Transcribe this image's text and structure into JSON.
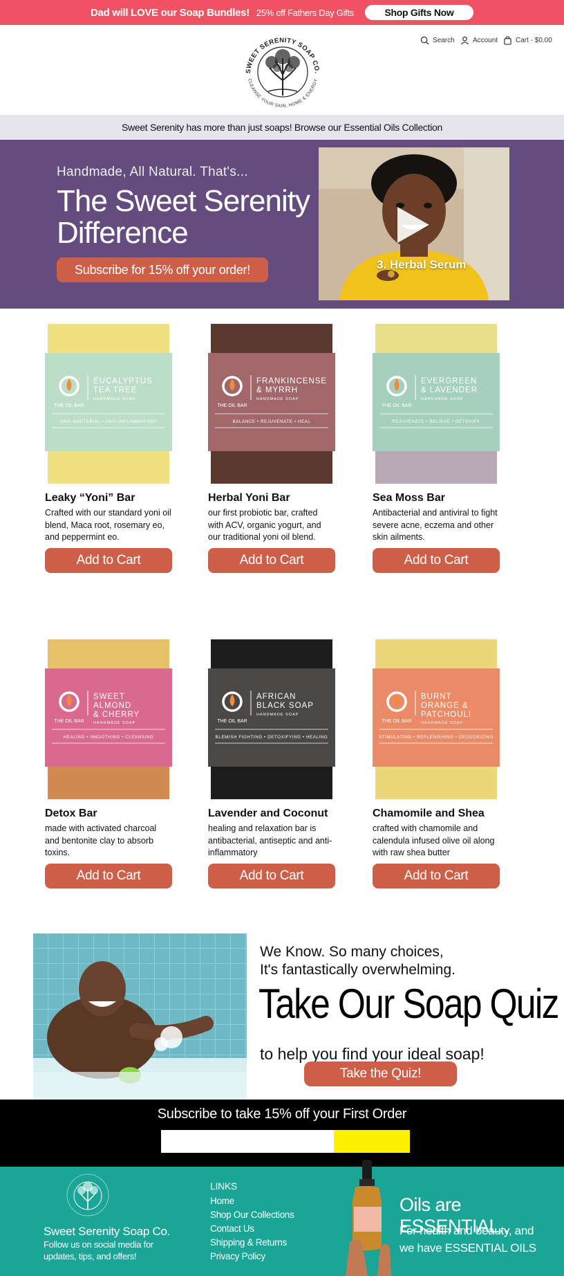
{
  "announcement": {
    "bold_text": "Dad will LOVE our Soap Bundles!",
    "thin_text": "25% off Fathers Day Gifts",
    "button_label": "Shop Gifts Now"
  },
  "header": {
    "logo_text_top": "SWEET SERENITY SOAP CO.",
    "logo_text_bottom": "CLEANSE YOUR SKIN, HOME & ENERGY",
    "search_label": "Search",
    "account_label": "Account",
    "cart_label": "Cart - $0.00"
  },
  "subbar": {
    "text": "Sweet Serenity has more than just soaps! Browse our Essential Oils Collection"
  },
  "hero": {
    "kicker": "Handmade, All Natural. That's...",
    "headline_line1": "The Sweet Serenity",
    "headline_line2": "Difference",
    "cta_label": "Subscribe for 15% off your order!",
    "video_caption": "3. Herbal Serum"
  },
  "products": [
    {
      "name": "Leaky “Yoni” Bar",
      "desc": "Crafted with our standard yoni oil blend, Maca root, rosemary eo, and peppermint eo.",
      "button": "Add to Cart",
      "label_line1": "EUCALYPTUS",
      "label_line2": "TEA TREE",
      "label_line3": "",
      "label_tag": "ANTI-BACTERIAL • ANTI-INFLAMMATORY",
      "wrap_color": "#b7dcc4",
      "soap_color": "#efe082",
      "soap_color2": "#efe082"
    },
    {
      "name": "Herbal Yoni Bar",
      "desc": "our first probiotic bar, crafted with ACV, organic yogurt, and our traditional yoni oil blend.",
      "button": "Add to Cart",
      "label_line1": "FRANKINCENSE",
      "label_line2": "& MYRRH",
      "label_line3": "",
      "label_tag": "BALANCE • REJUVENATE • HEAL",
      "wrap_color": "#9b5b5e",
      "soap_color": "#5a3a2e",
      "soap_color2": "#5a3a2e"
    },
    {
      "name": "Sea Moss Bar",
      "desc": "Antibacterial and antiviral to fight severe acne, eczema and other skin ailments.",
      "button": "Add to Cart",
      "label_line1": "EVERGREEN",
      "label_line2": "& LAVENDER",
      "label_line3": "",
      "label_tag": "REJUVENATE • RELIEVE • DETOXIFY",
      "wrap_color": "#9ecdb9",
      "soap_color": "#e9df8a",
      "soap_color2": "#b9a9b7"
    },
    {
      "name": "Detox Bar",
      "desc": "made with activated charcoal and bentonite clay to absorb toxins.",
      "button": "Add to Cart",
      "label_line1": "SWEET",
      "label_line2": "ALMOND",
      "label_line3": "& CHERRY",
      "label_tag": "HEALING • SMOOTHING • CLEANSING",
      "wrap_color": "#d65d86",
      "soap_color": "#e7c06a",
      "soap_color2": "#d38a52"
    },
    {
      "name": "Lavender and Coconut",
      "desc": "healing and relaxation bar is antibacterial, antiseptic and anti-inflammatory",
      "button": "Add to Cart",
      "label_line1": "AFRICAN",
      "label_line2": "BLACK SOAP",
      "label_line3": "",
      "label_tag": "BLEMISH FIGHTING • DETOXIFYING • HEALING",
      "wrap_color": "#3c3835",
      "soap_color": "#1d1d1e",
      "soap_color2": "#1d1d1e"
    },
    {
      "name": "Chamomile and Shea",
      "desc": "crafted with chamomile and calendula infused olive oil along with raw shea butter",
      "button": "Add to Cart",
      "label_line1": "BURNT",
      "label_line2": "ORANGE &",
      "label_line3": "PATCHOULI",
      "label_tag": "STIMULATING • REPLENISHING • DEODORIZING",
      "wrap_color": "#ea8059",
      "soap_color": "#e9d77a",
      "soap_color2": "#e9d77a"
    }
  ],
  "oil_bar_brand": "THE OIL BAR",
  "oil_bar_sub": "HANDMADE SOAP",
  "quiz": {
    "line1": "We Know. So many choices,",
    "line2": "It's fantastically overwhelming.",
    "title": "Take Our Soap Quiz",
    "subtitle": "to help you find your ideal soap!",
    "button_label": "Take the Quiz!"
  },
  "subscribe": {
    "title": "Subscribe to take 15% off your First Order",
    "email_placeholder": "",
    "submit_label": ""
  },
  "footer": {
    "brand": "Sweet Serenity Soap Co.",
    "follow": "Follow us on social media for updates, tips, and offers!",
    "links_heading": "LINKS",
    "links": [
      "Home",
      "Shop Our Collections",
      "Contact Us",
      "Shipping & Returns",
      "Privacy Policy"
    ],
    "oils_heading": "Oils are ESSENTIAL..",
    "oils_text": "For health and beauty, and we have ESSENTIAL OILS"
  },
  "colors": {
    "announce_bg": "#f05263",
    "hero_bg": "#654c7e",
    "button": "#cd5f48",
    "subscribe_submit": "#fff200",
    "footer_bg": "#1aa596"
  }
}
